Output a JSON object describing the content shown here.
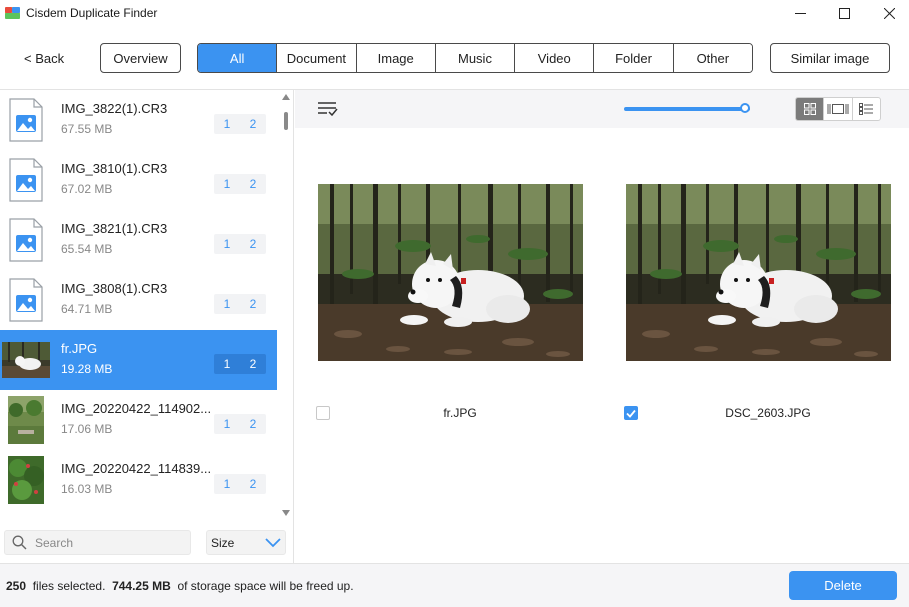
{
  "window": {
    "title": "Cisdem Duplicate Finder",
    "icon": "app-logo-icon"
  },
  "toolbar": {
    "back_label": "< Back",
    "overview_label": "Overview",
    "similar_label": "Similar image",
    "tabs": [
      {
        "label": "All",
        "active": true
      },
      {
        "label": "Document",
        "active": false
      },
      {
        "label": "Image",
        "active": false
      },
      {
        "label": "Music",
        "active": false
      },
      {
        "label": "Video",
        "active": false
      },
      {
        "label": "Folder",
        "active": false
      },
      {
        "label": "Other",
        "active": false
      }
    ]
  },
  "file_list": {
    "items": [
      {
        "name": "IMG_3822(1).CR3",
        "size": "67.55 MB",
        "count_a": "1",
        "count_b": "2",
        "thumb": "image-file-icon",
        "selected": false
      },
      {
        "name": "IMG_3810(1).CR3",
        "size": "67.02 MB",
        "count_a": "1",
        "count_b": "2",
        "thumb": "image-file-icon",
        "selected": false
      },
      {
        "name": "IMG_3821(1).CR3",
        "size": "65.54 MB",
        "count_a": "1",
        "count_b": "2",
        "thumb": "image-file-icon",
        "selected": false
      },
      {
        "name": "IMG_3808(1).CR3",
        "size": "64.71 MB",
        "count_a": "1",
        "count_b": "2",
        "thumb": "image-file-icon",
        "selected": false
      },
      {
        "name": "fr.JPG",
        "size": "19.28 MB",
        "count_a": "1",
        "count_b": "2",
        "thumb": "dog-photo-thumbnail",
        "selected": true
      },
      {
        "name": "IMG_20220422_114902...",
        "size": "17.06 MB",
        "count_a": "1",
        "count_b": "2",
        "thumb": "garden-photo-thumbnail",
        "selected": false
      },
      {
        "name": "IMG_20220422_114839...",
        "size": "16.03 MB",
        "count_a": "1",
        "count_b": "2",
        "thumb": "plant-photo-thumbnail",
        "selected": false
      }
    ]
  },
  "search": {
    "placeholder": "Search",
    "value": ""
  },
  "sort": {
    "selected": "Size"
  },
  "preview": {
    "zoom_fraction": 1.0,
    "view_modes": [
      "grid-view-icon",
      "compare-view-icon",
      "list-view-icon"
    ],
    "active_view": "grid-view-icon",
    "cards": [
      {
        "name": "fr.JPG",
        "checked": false
      },
      {
        "name": "DSC_2603.JPG",
        "checked": true
      }
    ]
  },
  "status": {
    "files_count": "250",
    "files_text": "files selected.",
    "size": "744.25 MB",
    "size_text": "of storage space will be freed up."
  },
  "actions": {
    "delete_label": "Delete"
  },
  "colors": {
    "accent": "#3b93f1",
    "selected_row": "#3b93f1",
    "count_text": "#3b93f1"
  }
}
